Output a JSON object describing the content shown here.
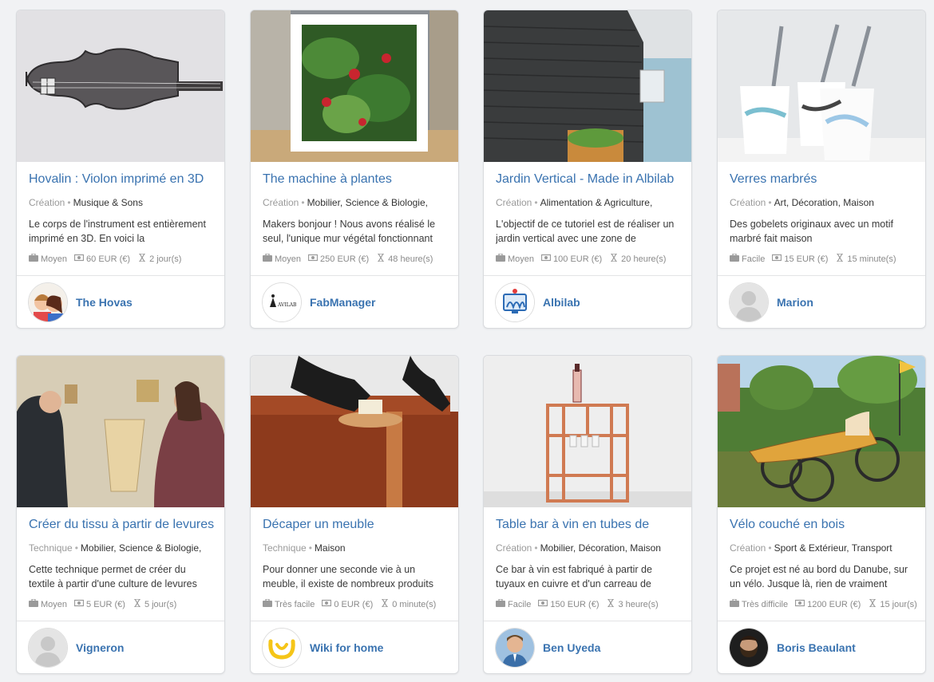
{
  "colors": {
    "link": "#3a73b0",
    "muted": "#9a9a9a",
    "text": "#3a3a3a",
    "background": "#f1f2f4"
  },
  "projects": [
    {
      "title": "Hovalin : Violon imprimé en 3D",
      "type": "Création",
      "categories": "Musique & Sons",
      "description": "Le corps de l'instrument est entièrement imprimé en 3D. En voici la",
      "difficulty": "Moyen",
      "cost": "60 EUR (€)",
      "duration": "2 jour(s)",
      "author": "The Hovas",
      "image_icon": "violin-photo",
      "avatar_icon": "couple-cartoon-avatar"
    },
    {
      "title": "The machine à plantes",
      "type": "Création",
      "categories": "Mobilier, Science & Biologie,",
      "description": "Makers bonjour ! Nous avons réalisé le seul, l'unique mur végétal fonctionnant",
      "difficulty": "Moyen",
      "cost": "250 EUR (€)",
      "duration": "48 heure(s)",
      "author": "FabManager",
      "image_icon": "plant-frame-photo",
      "avatar_icon": "avilab-logo-avatar"
    },
    {
      "title": "Jardin Vertical - Made in Albilab",
      "type": "Création",
      "categories": "Alimentation & Agriculture,",
      "description": "L'objectif de ce tutoriel est de réaliser un jardin vertical avec une zone de",
      "difficulty": "Moyen",
      "cost": "100 EUR (€)",
      "duration": "20 heure(s)",
      "author": "Albilab",
      "image_icon": "stone-wall-garden-photo",
      "avatar_icon": "albilab-logo-avatar"
    },
    {
      "title": "Verres marbrés",
      "type": "Création",
      "categories": "Art, Décoration, Maison",
      "description": "Des gobelets originaux avec un motif marbré fait maison",
      "difficulty": "Facile",
      "cost": "15 EUR (€)",
      "duration": "15 minute(s)",
      "author": "Marion",
      "image_icon": "marbled-cups-photo",
      "avatar_icon": "default-user-avatar"
    },
    {
      "title": "Créer du tissu à partir de levures",
      "type": "Technique",
      "categories": "Mobilier, Science & Biologie,",
      "description": "Cette technique permet de créer du textile à partir d'une culture de levures",
      "difficulty": "Moyen",
      "cost": "5 EUR (€)",
      "duration": "5 jour(s)",
      "author": "Vigneron",
      "image_icon": "yeast-fabric-photo",
      "avatar_icon": "default-user-avatar"
    },
    {
      "title": "Décaper un meuble",
      "type": "Technique",
      "categories": "Maison",
      "description": "Pour donner une seconde vie à un meuble, il existe de nombreux produits",
      "difficulty": "Très facile",
      "cost": "0 EUR (€)",
      "duration": "0 minute(s)",
      "author": "Wiki for home",
      "image_icon": "furniture-stripping-photo",
      "avatar_icon": "wiki-for-home-logo-avatar"
    },
    {
      "title": "Table bar à vin en tubes de",
      "type": "Création",
      "categories": "Mobilier, Décoration, Maison",
      "description": "Ce bar à vin est fabriqué à partir de tuyaux en cuivre et d'un carreau de",
      "difficulty": "Facile",
      "cost": "150 EUR (€)",
      "duration": "3 heure(s)",
      "author": "Ben Uyeda",
      "image_icon": "copper-wine-bar-photo",
      "avatar_icon": "man-portrait-avatar"
    },
    {
      "title": "Vélo couché en bois",
      "type": "Création",
      "categories": "Sport & Extérieur, Transport",
      "description": "Ce projet est né au bord du Danube, sur un vélo. Jusque là, rien de vraiment",
      "difficulty": "Très difficile",
      "cost": "1200 EUR (€)",
      "duration": "15 jour(s)",
      "author": "Boris Beaulant",
      "image_icon": "wooden-recumbent-bike-photo",
      "avatar_icon": "bearded-man-portrait-avatar"
    }
  ]
}
